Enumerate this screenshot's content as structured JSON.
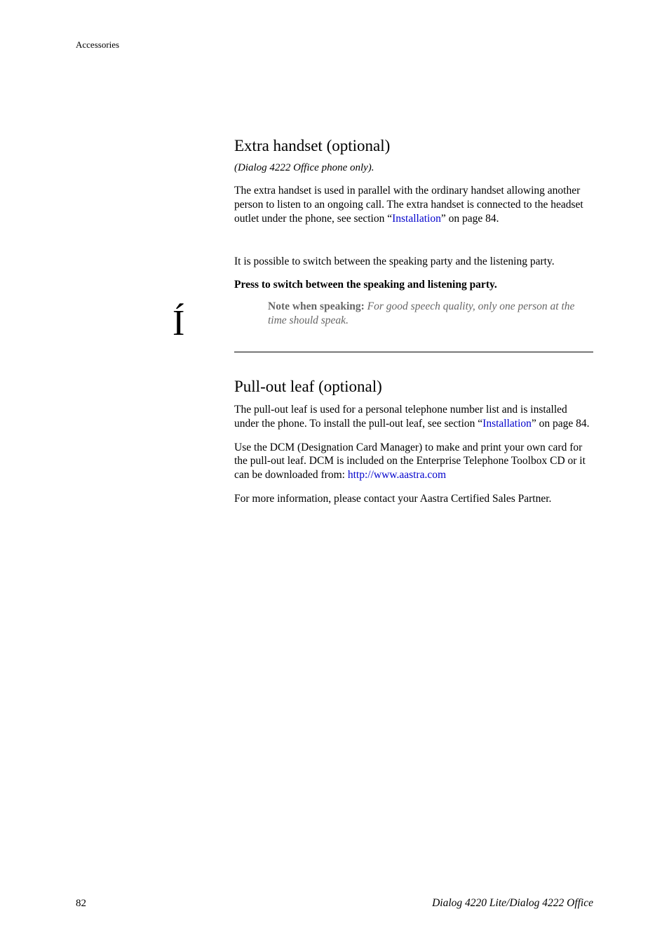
{
  "header": {
    "section_name": "Accessories"
  },
  "section1": {
    "heading": "Extra handset (optional)",
    "subtitle": "(Dialog 4222 Office phone only).",
    "p1_a": "The extra handset is used in parallel with the ordinary handset allowing another person to listen to an ongoing call. The extra handset is connected to the headset outlet under the phone, see section “",
    "p1_link": "Installation",
    "p1_b": "” on page 84.",
    "p2": "It is possible to switch between the speaking party and the listening party.",
    "key_glyph": "Í",
    "step": "Press to switch between the speaking and listening party.",
    "note_label": "Note when speaking: ",
    "note_text": "For good speech quality, only one person at the time should speak."
  },
  "section2": {
    "heading": "Pull-out leaf (optional)",
    "p1_a": "The pull-out leaf is used for a personal telephone number list and is installed under the phone. To install the pull-out leaf, see section “",
    "p1_link": "Installation",
    "p1_b": "” on page 84.",
    "p2_a": "Use the DCM (Designation Card Manager) to make and print your own card for the pull-out leaf. DCM is included on the Enterprise Telephone Toolbox CD or it can be downloaded from: ",
    "p2_link": "http://www.aastra.com",
    "p3": "For more information, please contact your Aastra Certified Sales Partner."
  },
  "footer": {
    "page_number": "82",
    "doc_title": "Dialog 4220 Lite/Dialog 4222 Office"
  }
}
